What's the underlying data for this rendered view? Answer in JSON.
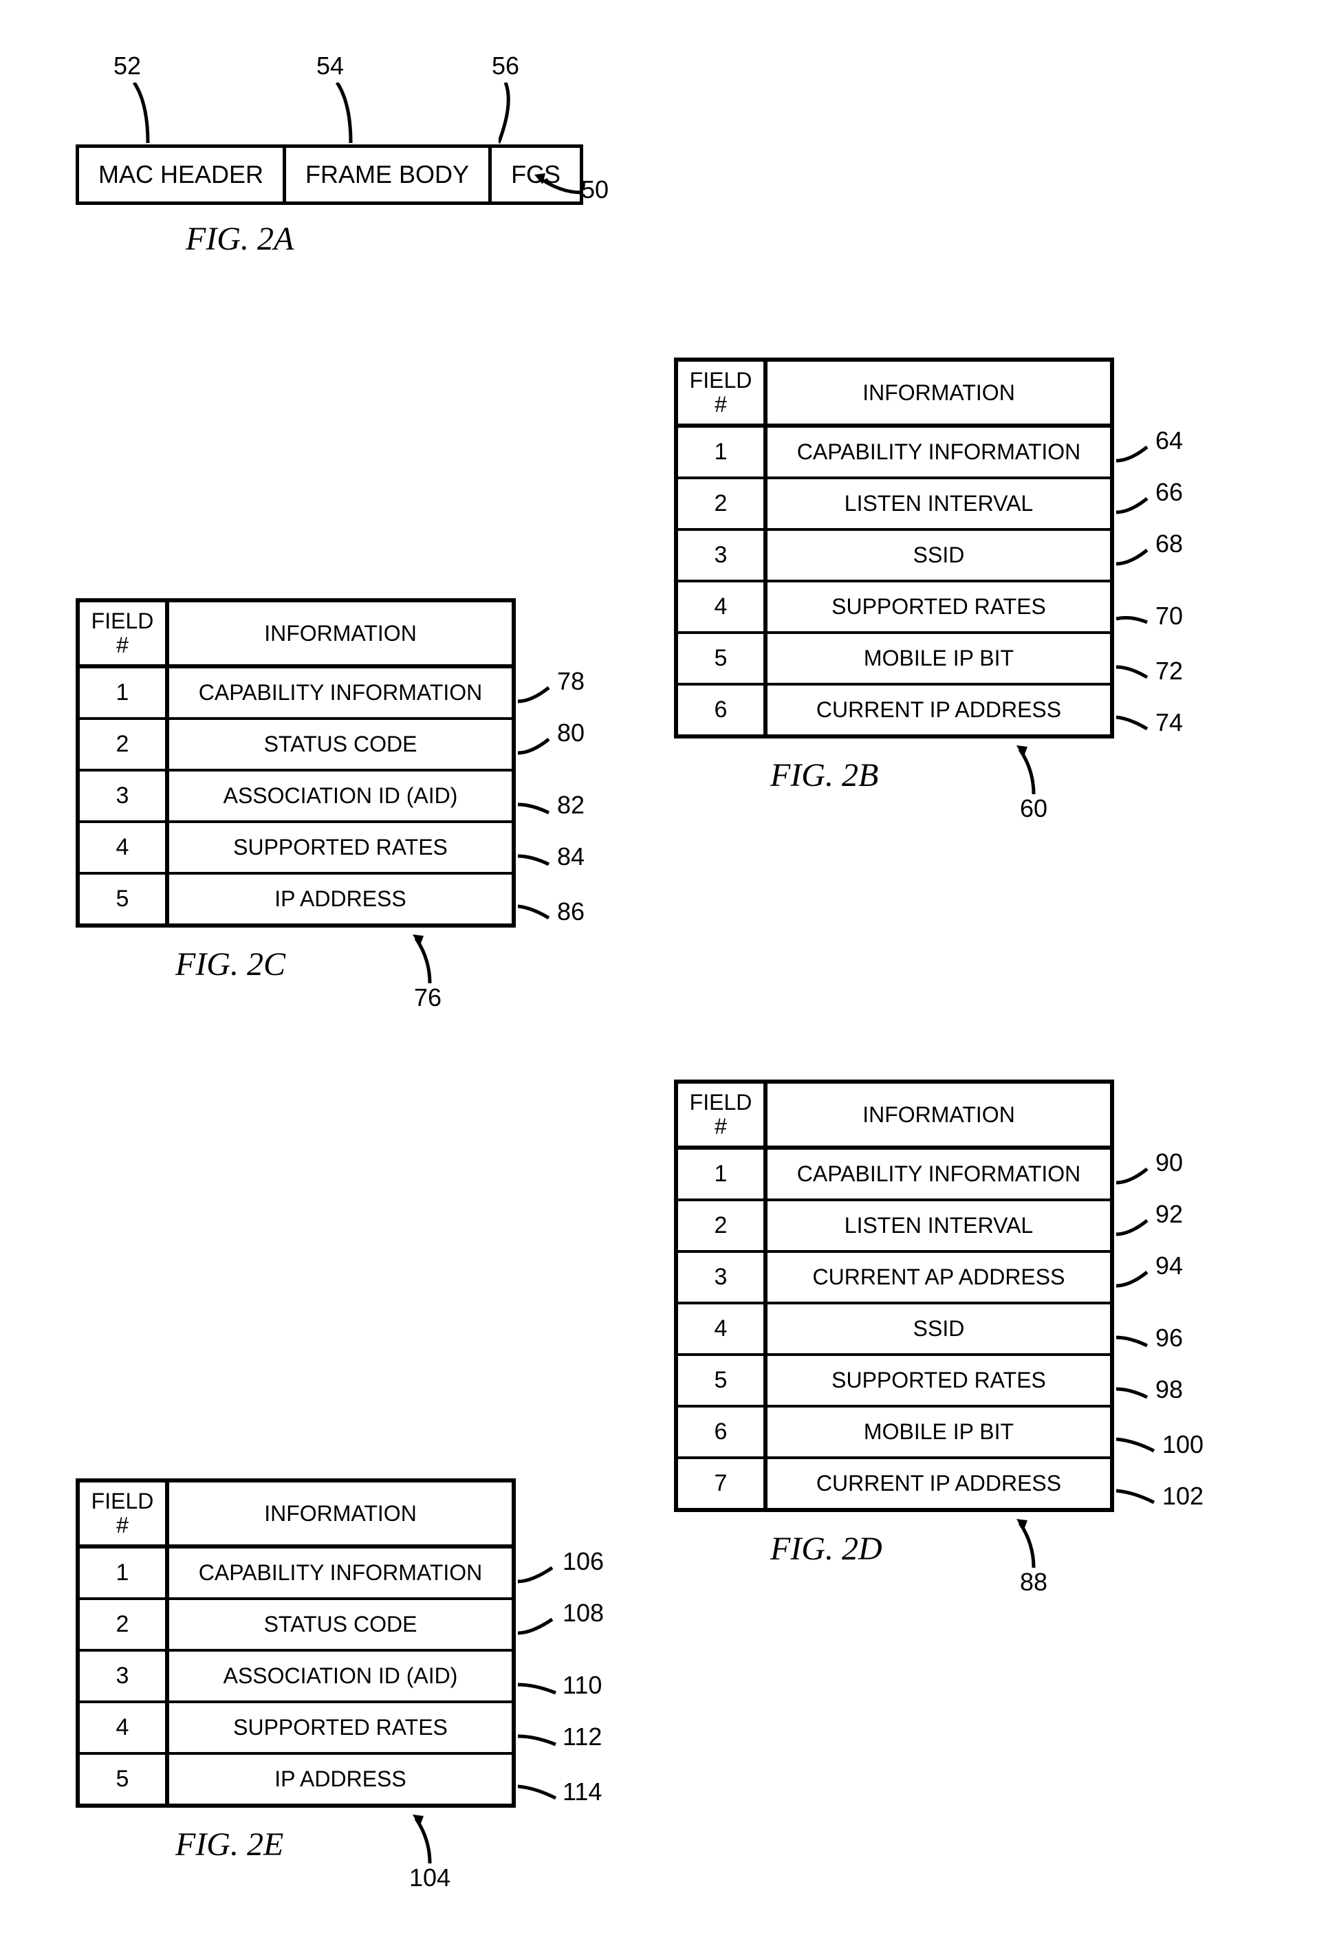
{
  "fig2a": {
    "refs": {
      "r52": "52",
      "r54": "54",
      "r56": "56",
      "r50": "50"
    },
    "cells": {
      "mac": "MAC HEADER",
      "body": "FRAME BODY",
      "fcs": "FCS"
    },
    "caption": "FIG. 2A"
  },
  "tables": {
    "b": {
      "header": {
        "field": "FIELD",
        "hash": "#",
        "info": "INFORMATION"
      },
      "rows": [
        {
          "n": "1",
          "info": "CAPABILITY INFORMATION",
          "ref": "64"
        },
        {
          "n": "2",
          "info": "LISTEN INTERVAL",
          "ref": "66"
        },
        {
          "n": "3",
          "info": "SSID",
          "ref": "68"
        },
        {
          "n": "4",
          "info": "SUPPORTED RATES",
          "ref": "70"
        },
        {
          "n": "5",
          "info": "MOBILE IP BIT",
          "ref": "72"
        },
        {
          "n": "6",
          "info": "CURRENT IP ADDRESS",
          "ref": "74"
        }
      ],
      "bottomRef": "60",
      "caption": "FIG. 2B"
    },
    "c": {
      "header": {
        "field": "FIELD",
        "hash": "#",
        "info": "INFORMATION"
      },
      "rows": [
        {
          "n": "1",
          "info": "CAPABILITY INFORMATION",
          "ref": "78"
        },
        {
          "n": "2",
          "info": "STATUS CODE",
          "ref": "80"
        },
        {
          "n": "3",
          "info": "ASSOCIATION ID (AID)",
          "ref": "82"
        },
        {
          "n": "4",
          "info": "SUPPORTED RATES",
          "ref": "84"
        },
        {
          "n": "5",
          "info": "IP ADDRESS",
          "ref": "86"
        }
      ],
      "bottomRef": "76",
      "caption": "FIG. 2C"
    },
    "d": {
      "header": {
        "field": "FIELD",
        "hash": "#",
        "info": "INFORMATION"
      },
      "rows": [
        {
          "n": "1",
          "info": "CAPABILITY INFORMATION",
          "ref": "90"
        },
        {
          "n": "2",
          "info": "LISTEN INTERVAL",
          "ref": "92"
        },
        {
          "n": "3",
          "info": "CURRENT AP ADDRESS",
          "ref": "94"
        },
        {
          "n": "4",
          "info": "SSID",
          "ref": "96"
        },
        {
          "n": "5",
          "info": "SUPPORTED RATES",
          "ref": "98"
        },
        {
          "n": "6",
          "info": "MOBILE IP BIT",
          "ref": "100"
        },
        {
          "n": "7",
          "info": "CURRENT IP ADDRESS",
          "ref": "102"
        }
      ],
      "bottomRef": "88",
      "caption": "FIG. 2D"
    },
    "e": {
      "header": {
        "field": "FIELD",
        "hash": "#",
        "info": "INFORMATION"
      },
      "rows": [
        {
          "n": "1",
          "info": "CAPABILITY INFORMATION",
          "ref": "106"
        },
        {
          "n": "2",
          "info": "STATUS CODE",
          "ref": "108"
        },
        {
          "n": "3",
          "info": "ASSOCIATION ID (AID)",
          "ref": "110"
        },
        {
          "n": "4",
          "info": "SUPPORTED RATES",
          "ref": "112"
        },
        {
          "n": "5",
          "info": "IP ADDRESS",
          "ref": "114"
        }
      ],
      "bottomRef": "104",
      "caption": "FIG. 2E"
    }
  }
}
